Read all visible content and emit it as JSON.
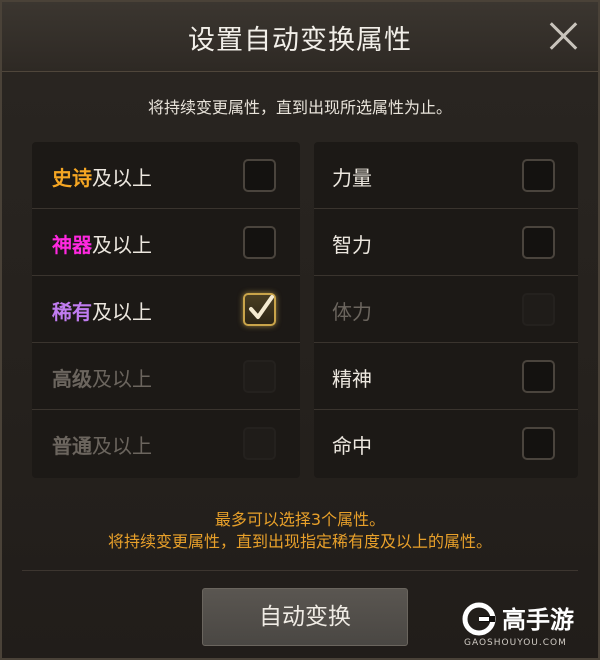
{
  "dialog": {
    "title": "设置自动变换属性",
    "subtitle": "将持续变更属性，直到出现所选属性为止。"
  },
  "rarity_options": [
    {
      "quality": "史诗",
      "suffix": "及以上",
      "color": "#f5a623",
      "checked": false,
      "enabled": true
    },
    {
      "quality": "神器",
      "suffix": "及以上",
      "color": "#ff28e0",
      "checked": false,
      "enabled": true
    },
    {
      "quality": "稀有",
      "suffix": "及以上",
      "color": "#c07cf0",
      "checked": true,
      "enabled": true
    },
    {
      "quality": "高级",
      "suffix": "及以上",
      "color": "#6b655e",
      "checked": false,
      "enabled": false
    },
    {
      "quality": "普通",
      "suffix": "及以上",
      "color": "#6b655e",
      "checked": false,
      "enabled": false
    }
  ],
  "attribute_options": [
    {
      "label": "力量",
      "checked": false,
      "enabled": true
    },
    {
      "label": "智力",
      "checked": false,
      "enabled": true
    },
    {
      "label": "体力",
      "checked": false,
      "enabled": false
    },
    {
      "label": "精神",
      "checked": false,
      "enabled": true
    },
    {
      "label": "命中",
      "checked": false,
      "enabled": true
    }
  ],
  "notice": {
    "line1": "最多可以选择3个属性。",
    "line2": "将持续变更属性，直到出现指定稀有度及以上的属性。"
  },
  "action_button": {
    "label": "自动变换"
  },
  "watermark": {
    "brand": "高手游",
    "url": "GAOSHOUYOU.COM"
  },
  "colors": {
    "accent_orange": "#e8a02a",
    "check_gold": "#c9a44a"
  }
}
